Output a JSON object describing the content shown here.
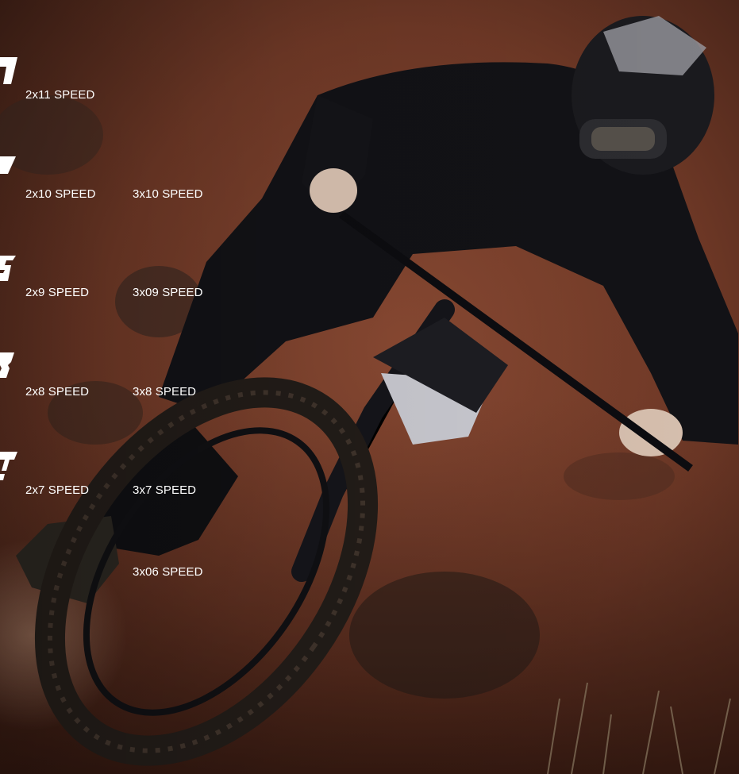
{
  "scene": {
    "alt_subject": "downhill-rider-photo"
  },
  "speed_groups": [
    {
      "id": "11",
      "double": "2x11 SPEED",
      "triple": ""
    },
    {
      "id": "10",
      "double": "2x10 SPEED",
      "triple": "3x10 SPEED"
    },
    {
      "id": "9",
      "double": "2x9 SPEED",
      "triple": "3x09 SPEED"
    },
    {
      "id": "8",
      "double": "2x8 SPEED",
      "triple": "3x8 SPEED"
    },
    {
      "id": "7",
      "double": "2x7 SPEED",
      "triple": "3x7 SPEED"
    },
    {
      "id": "6",
      "double": "",
      "triple": "3x06 SPEED"
    }
  ],
  "colors": {
    "dirt": "#7a3f2a",
    "dirt_dark": "#3b1f16",
    "rider": "#111114",
    "text": "#ffffff"
  }
}
